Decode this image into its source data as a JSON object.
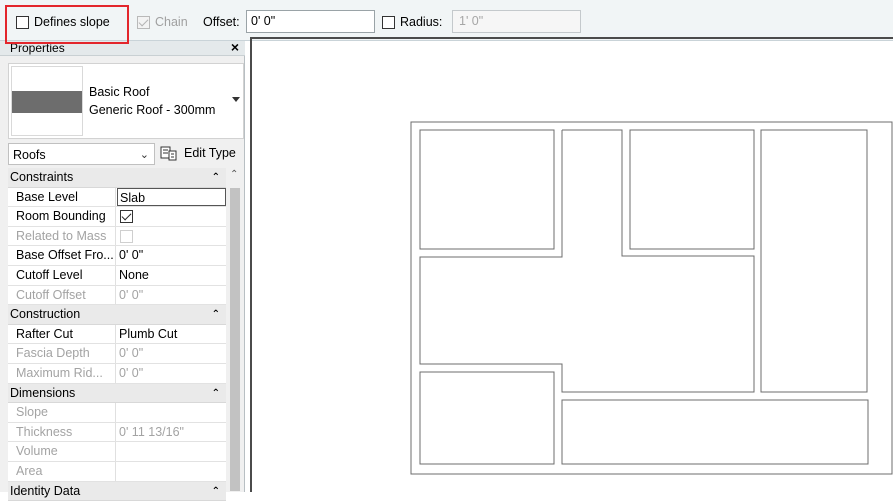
{
  "options_bar": {
    "defines_slope": {
      "label": "Defines slope",
      "checked": false
    },
    "chain": {
      "label": "Chain",
      "checked": true,
      "enabled": false
    },
    "offset": {
      "label": "Offset:",
      "value": "0'  0\""
    },
    "radius": {
      "label": "Radius:",
      "checked": false,
      "value": "1'  0\"",
      "enabled": false
    },
    "highlight_color": "#e3262c"
  },
  "properties": {
    "title": "Properties",
    "close_glyph": "×",
    "type_selector": {
      "family": "Basic Roof",
      "type": "Generic Roof - 300mm"
    },
    "category": "Roofs",
    "edit_type_label": "Edit Type",
    "sections": [
      {
        "name": "Constraints",
        "rows": [
          {
            "key": "Base Level",
            "value": "Slab",
            "editing": true
          },
          {
            "key": "Room Bounding",
            "value": "",
            "checkbox": true,
            "checked": true
          },
          {
            "key": "Related to Mass",
            "value": "",
            "checkbox": true,
            "checked": false,
            "disabled": true
          },
          {
            "key": "Base Offset Fro...",
            "value": "0'  0\""
          },
          {
            "key": "Cutoff Level",
            "value": "None"
          },
          {
            "key": "Cutoff Offset",
            "value": "0'  0\"",
            "disabled": true
          }
        ]
      },
      {
        "name": "Construction",
        "rows": [
          {
            "key": "Rafter Cut",
            "value": "Plumb Cut"
          },
          {
            "key": "Fascia Depth",
            "value": "0'  0\"",
            "disabled": true
          },
          {
            "key": "Maximum Rid...",
            "value": "0'  0\"",
            "disabled": true
          }
        ]
      },
      {
        "name": "Dimensions",
        "rows": [
          {
            "key": "Slope",
            "value": "",
            "disabled": true
          },
          {
            "key": "Thickness",
            "value": "0'  11 13/16\"",
            "disabled": true
          },
          {
            "key": "Volume",
            "value": "",
            "disabled": true
          },
          {
            "key": "Area",
            "value": "",
            "disabled": true
          }
        ]
      },
      {
        "name": "Identity Data",
        "rows": []
      }
    ]
  },
  "colors": {
    "accent_highlight": "#e3262c",
    "panel_bg": "#f0f0f0",
    "optbar_bg": "#f1f5f6"
  }
}
